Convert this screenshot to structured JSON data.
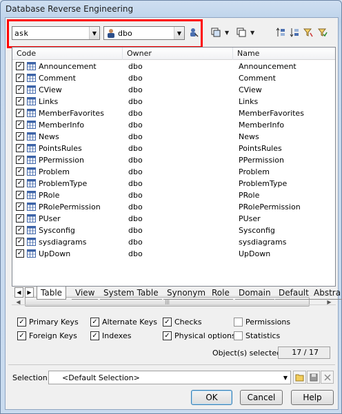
{
  "window": {
    "title": "Database Reverse Engineering"
  },
  "toolbar": {
    "database_value": "ask",
    "owner_value": "dbo"
  },
  "columns": {
    "code": "Code",
    "owner": "Owner",
    "name": "Name"
  },
  "rows": [
    {
      "code": "Announcement",
      "owner": "dbo",
      "name": "Announcement",
      "checked": true
    },
    {
      "code": "Comment",
      "owner": "dbo",
      "name": "Comment",
      "checked": true
    },
    {
      "code": "CView",
      "owner": "dbo",
      "name": "CView",
      "checked": true
    },
    {
      "code": "Links",
      "owner": "dbo",
      "name": "Links",
      "checked": true
    },
    {
      "code": "MemberFavorites",
      "owner": "dbo",
      "name": "MemberFavorites",
      "checked": true
    },
    {
      "code": "MemberInfo",
      "owner": "dbo",
      "name": "MemberInfo",
      "checked": true
    },
    {
      "code": "News",
      "owner": "dbo",
      "name": "News",
      "checked": true
    },
    {
      "code": "PointsRules",
      "owner": "dbo",
      "name": "PointsRules",
      "checked": true
    },
    {
      "code": "PPermission",
      "owner": "dbo",
      "name": "PPermission",
      "checked": true
    },
    {
      "code": "Problem",
      "owner": "dbo",
      "name": "Problem",
      "checked": true
    },
    {
      "code": "ProblemType",
      "owner": "dbo",
      "name": "ProblemType",
      "checked": true
    },
    {
      "code": "PRole",
      "owner": "dbo",
      "name": "PRole",
      "checked": true
    },
    {
      "code": "PRolePermission",
      "owner": "dbo",
      "name": "PRolePermission",
      "checked": true
    },
    {
      "code": "PUser",
      "owner": "dbo",
      "name": "PUser",
      "checked": true
    },
    {
      "code": "Sysconfig",
      "owner": "dbo",
      "name": "Sysconfig",
      "checked": true
    },
    {
      "code": "sysdiagrams",
      "owner": "dbo",
      "name": "sysdiagrams",
      "checked": true
    },
    {
      "code": "UpDown",
      "owner": "dbo",
      "name": "UpDown",
      "checked": true
    }
  ],
  "tabs": [
    "Table",
    "View",
    "System Table",
    "Synonym",
    "Role",
    "Domain",
    "Default",
    "Abstra"
  ],
  "active_tab": "Table",
  "options": {
    "primary_keys": {
      "label": "Primary Keys",
      "checked": true
    },
    "foreign_keys": {
      "label": "Foreign Keys",
      "checked": true
    },
    "alternate_keys": {
      "label": "Alternate Keys",
      "checked": true
    },
    "indexes": {
      "label": "Indexes",
      "checked": true
    },
    "checks": {
      "label": "Checks",
      "checked": true
    },
    "physical_options": {
      "label": "Physical options",
      "checked": true
    },
    "permissions": {
      "label": "Permissions",
      "checked": false
    },
    "statistics": {
      "label": "Statistics",
      "checked": false
    }
  },
  "objects_selected": {
    "label": "Object(s) selected:",
    "value": "17 / 17"
  },
  "selection": {
    "label": "Selection:",
    "value": "<Default Selection>"
  },
  "buttons": {
    "ok": "OK",
    "cancel": "Cancel",
    "help": "Help"
  },
  "colors": {
    "highlight": "#ff0000",
    "title_bg": "#c7d9ee"
  }
}
